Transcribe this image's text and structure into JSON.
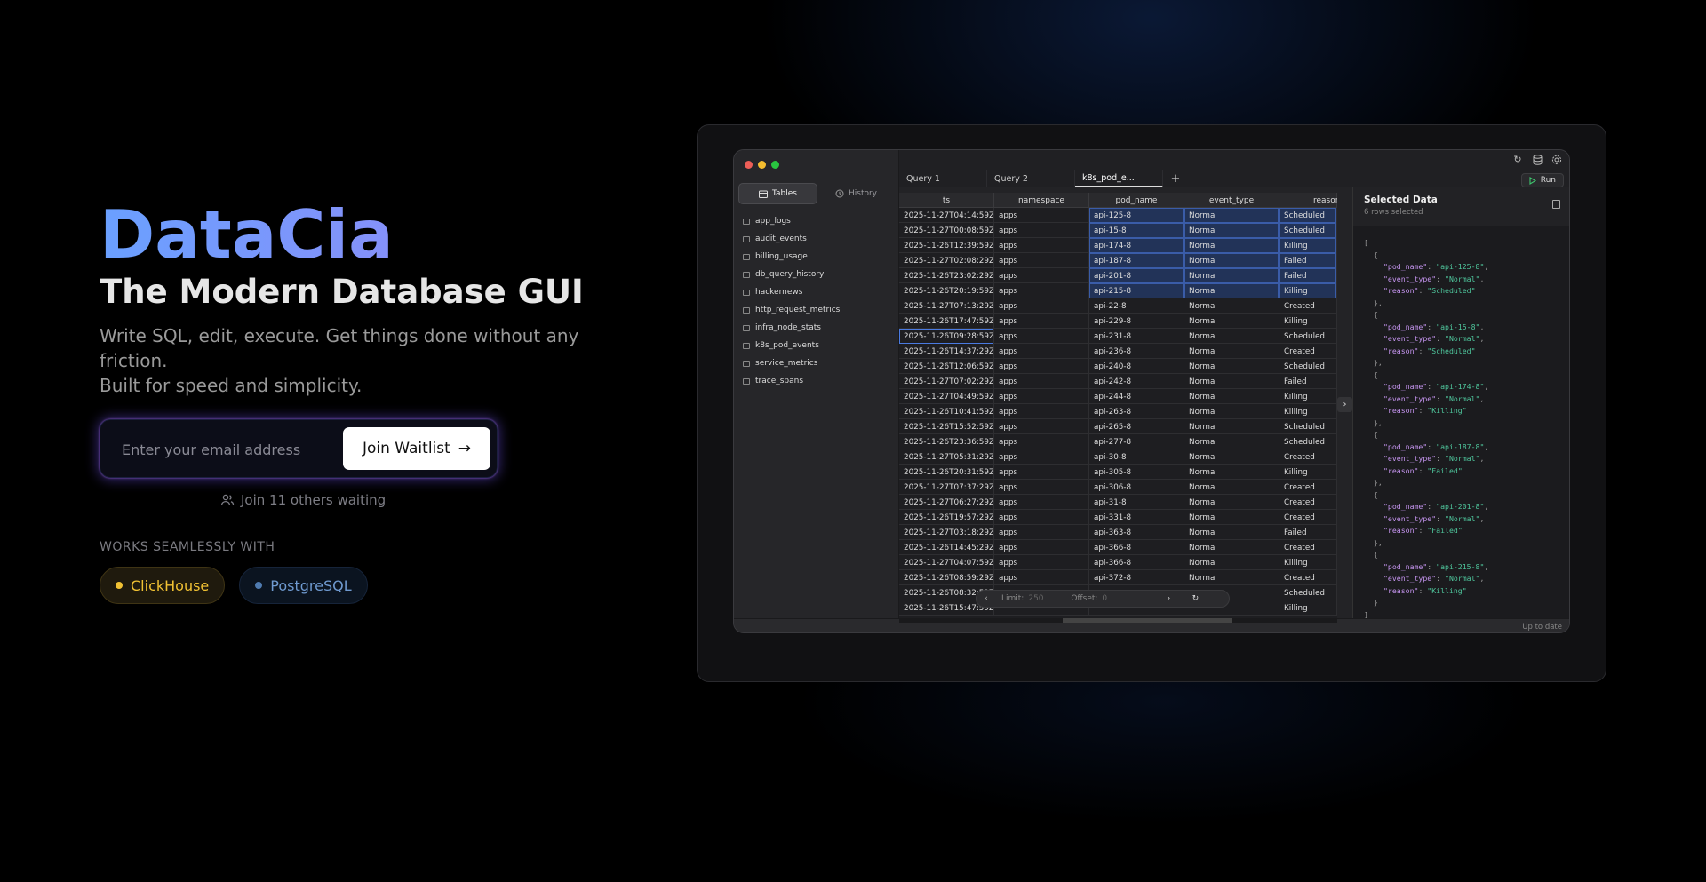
{
  "hero": {
    "brand": "DataCia",
    "tagline": "The Modern Database GUI",
    "desc_line1": "Write SQL, edit, execute. Get things done without any friction.",
    "desc_line2": "Built for speed and simplicity.",
    "email_placeholder": "Enter your email address",
    "join_label": "Join Waitlist",
    "others_label": "Join 11 others waiting",
    "works_label": "WORKS SEAMLESSLY WITH",
    "integrations": [
      "ClickHouse",
      "PostgreSQL"
    ]
  },
  "app": {
    "sidebar_tabs": [
      "Tables",
      "History"
    ],
    "tables": [
      "app_logs",
      "audit_events",
      "billing_usage",
      "db_query_history",
      "hackernews",
      "http_request_metrics",
      "infra_node_stats",
      "k8s_pod_events",
      "service_metrics",
      "trace_spans"
    ],
    "query_tabs": [
      "Query 1",
      "Query 2",
      "k8s_pod_e..."
    ],
    "run_label": "Run",
    "columns": [
      "ts",
      "namespace",
      "pod_name",
      "event_type",
      "reason"
    ],
    "rows": [
      [
        "2025-11-27T04:14:59Z",
        "apps",
        "api-125-8",
        "Normal",
        "Scheduled"
      ],
      [
        "2025-11-27T00:08:59Z",
        "apps",
        "api-15-8",
        "Normal",
        "Scheduled"
      ],
      [
        "2025-11-26T12:39:59Z",
        "apps",
        "api-174-8",
        "Normal",
        "Killing"
      ],
      [
        "2025-11-27T02:08:29Z",
        "apps",
        "api-187-8",
        "Normal",
        "Failed"
      ],
      [
        "2025-11-26T23:02:29Z",
        "apps",
        "api-201-8",
        "Normal",
        "Failed"
      ],
      [
        "2025-11-26T20:19:59Z",
        "apps",
        "api-215-8",
        "Normal",
        "Killing"
      ],
      [
        "2025-11-27T07:13:29Z",
        "apps",
        "api-22-8",
        "Normal",
        "Created"
      ],
      [
        "2025-11-26T17:47:59Z",
        "apps",
        "api-229-8",
        "Normal",
        "Killing"
      ],
      [
        "2025-11-26T09:28:59Z",
        "apps",
        "api-231-8",
        "Normal",
        "Scheduled"
      ],
      [
        "2025-11-26T14:37:29Z",
        "apps",
        "api-236-8",
        "Normal",
        "Created"
      ],
      [
        "2025-11-26T12:06:59Z",
        "apps",
        "api-240-8",
        "Normal",
        "Scheduled"
      ],
      [
        "2025-11-27T07:02:29Z",
        "apps",
        "api-242-8",
        "Normal",
        "Failed"
      ],
      [
        "2025-11-27T04:49:59Z",
        "apps",
        "api-244-8",
        "Normal",
        "Killing"
      ],
      [
        "2025-11-26T10:41:59Z",
        "apps",
        "api-263-8",
        "Normal",
        "Killing"
      ],
      [
        "2025-11-26T15:52:59Z",
        "apps",
        "api-265-8",
        "Normal",
        "Scheduled"
      ],
      [
        "2025-11-26T23:36:59Z",
        "apps",
        "api-277-8",
        "Normal",
        "Scheduled"
      ],
      [
        "2025-11-27T05:31:29Z",
        "apps",
        "api-30-8",
        "Normal",
        "Created"
      ],
      [
        "2025-11-26T20:31:59Z",
        "apps",
        "api-305-8",
        "Normal",
        "Killing"
      ],
      [
        "2025-11-27T07:37:29Z",
        "apps",
        "api-306-8",
        "Normal",
        "Created"
      ],
      [
        "2025-11-27T06:27:29Z",
        "apps",
        "api-31-8",
        "Normal",
        "Created"
      ],
      [
        "2025-11-26T19:57:29Z",
        "apps",
        "api-331-8",
        "Normal",
        "Created"
      ],
      [
        "2025-11-27T03:18:29Z",
        "apps",
        "api-363-8",
        "Normal",
        "Failed"
      ],
      [
        "2025-11-26T14:45:29Z",
        "apps",
        "api-366-8",
        "Normal",
        "Created"
      ],
      [
        "2025-11-27T04:07:59Z",
        "apps",
        "api-366-8",
        "Normal",
        "Killing"
      ],
      [
        "2025-11-26T08:59:29Z",
        "apps",
        "api-372-8",
        "Normal",
        "Created"
      ],
      [
        "2025-11-26T08:32:59Z",
        "",
        "",
        "",
        "Scheduled"
      ],
      [
        "2025-11-26T15:47:59Z",
        "",
        "",
        "",
        "Killing"
      ]
    ],
    "pager": {
      "limit_label": "Limit:",
      "limit": "250",
      "offset_label": "Offset:",
      "offset": "0"
    },
    "status": "Up to date",
    "panel": {
      "title": "Selected Data",
      "subtitle": "6 rows selected",
      "records": [
        {
          "pod_name": "api-125-8",
          "event_type": "Normal",
          "reason": "Scheduled"
        },
        {
          "pod_name": "api-15-8",
          "event_type": "Normal",
          "reason": "Scheduled"
        },
        {
          "pod_name": "api-174-8",
          "event_type": "Normal",
          "reason": "Killing"
        },
        {
          "pod_name": "api-187-8",
          "event_type": "Normal",
          "reason": "Failed"
        },
        {
          "pod_name": "api-201-8",
          "event_type": "Normal",
          "reason": "Failed"
        },
        {
          "pod_name": "api-215-8",
          "event_type": "Normal",
          "reason": "Killing"
        }
      ]
    }
  },
  "colors": {
    "accent_from": "#6aa0ff",
    "accent_to": "#9a85f5",
    "selection": "#223358",
    "clickhouse": "#f0c133",
    "postgres": "#6f9ad0"
  }
}
